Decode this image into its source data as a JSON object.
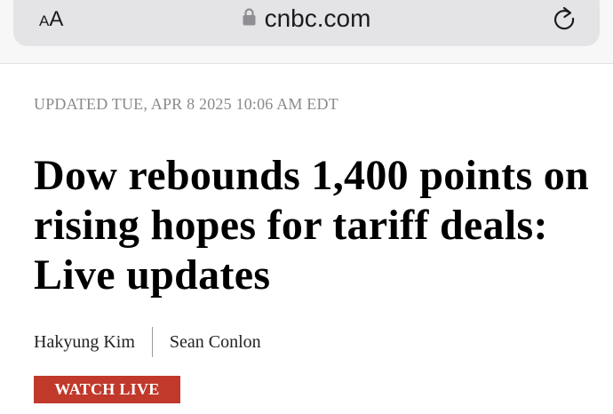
{
  "browser": {
    "text_size_small": "A",
    "text_size_big": "A",
    "url": "cnbc.com"
  },
  "article": {
    "updated": "UPDATED TUE, APR 8 2025 10:06 AM EDT",
    "headline": "Dow rebounds 1,400 points on rising hopes for tariff deals: Live updates",
    "authors": [
      "Hakyung Kim",
      "Sean Conlon"
    ],
    "watch_live_label": "WATCH LIVE"
  },
  "colors": {
    "watch_live_bg": "#c0392b",
    "updated_text": "#8a8a8a"
  }
}
